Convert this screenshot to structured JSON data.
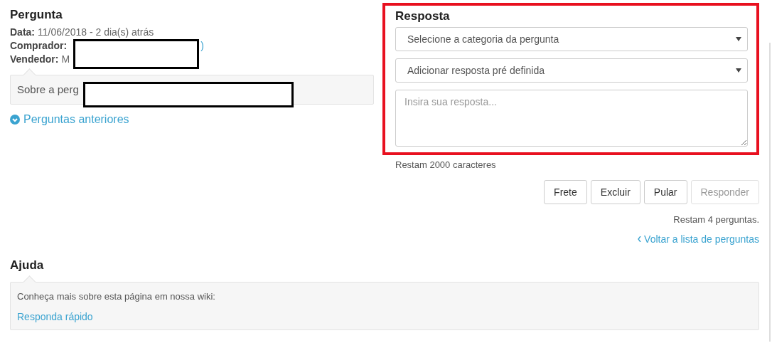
{
  "question": {
    "title": "Pergunta",
    "date_label": "Data:",
    "date": "11/06/2018 - 2 dia(s) atrás",
    "buyer_label": "Comprador:",
    "buyer_value": ")",
    "seller_label": "Vendedor:",
    "seller_value": "M",
    "question_text": "Sobre a perg",
    "previous_link": "Perguntas anteriores"
  },
  "answer": {
    "title": "Resposta",
    "category_select": "Selecione a categoria da pergunta",
    "preset_select": "Adicionar resposta pré definida",
    "reply_placeholder": "Insira sua resposta...",
    "chars_left": "Restam 2000 caracteres",
    "buttons": [
      {
        "label": "Frete",
        "disabled": false
      },
      {
        "label": "Excluir",
        "disabled": false
      },
      {
        "label": "Pular",
        "disabled": false
      },
      {
        "label": "Responder",
        "disabled": true
      }
    ],
    "questions_left": "Restam 4 perguntas.",
    "back_link": "Voltar a lista de perguntas"
  },
  "help": {
    "title": "Ajuda",
    "text": "Conheça mais sobre esta página em nossa wiki:",
    "link": "Responda rápido"
  }
}
